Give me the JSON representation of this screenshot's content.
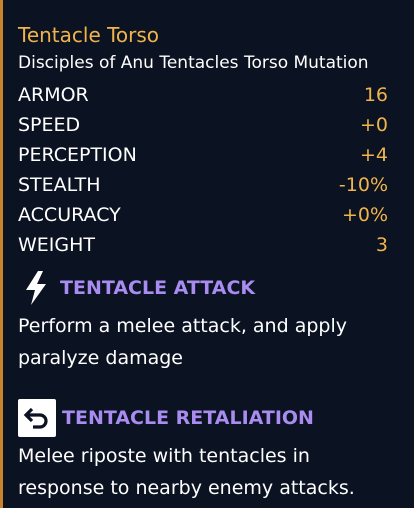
{
  "item": {
    "title": "Tentacle Torso",
    "subtitle": "Disciples of Anu Tentacles Torso Mutation"
  },
  "stats": [
    {
      "name": "ARMOR",
      "value": "16"
    },
    {
      "name": "SPEED",
      "value": "+0"
    },
    {
      "name": "PERCEPTION",
      "value": "+4"
    },
    {
      "name": "STEALTH",
      "value": "-10%"
    },
    {
      "name": "ACCURACY",
      "value": "+0%"
    },
    {
      "name": "WEIGHT",
      "value": "3"
    }
  ],
  "abilities": [
    {
      "icon": "lightning-icon",
      "name": "TENTACLE ATTACK",
      "description": "Perform a melee attack, and apply paralyze damage"
    },
    {
      "icon": "return-arrow-icon",
      "name": "TENTACLE RETALIATION",
      "description": "Melee riposte with tentacles in response to nearby enemy attacks."
    }
  ],
  "colors": {
    "background": "#0b1221",
    "accent_border": "#c9832d",
    "title": "#f0b44c",
    "value": "#f0b44c",
    "ability_name": "#a88cf0",
    "text": "#ffffff"
  }
}
